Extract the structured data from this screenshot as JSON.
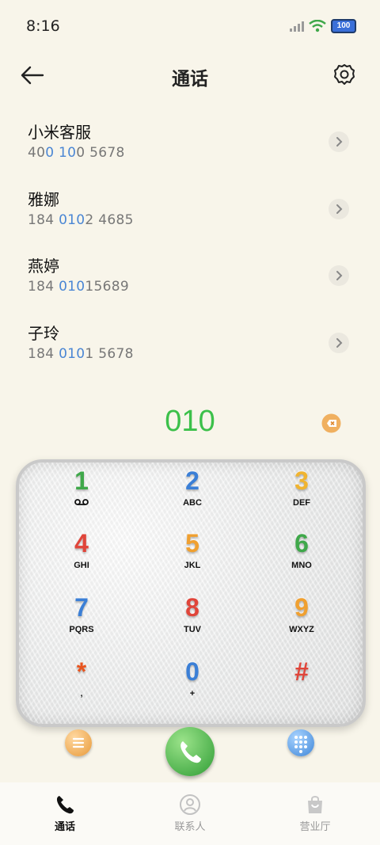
{
  "status_bar": {
    "time": "8:16",
    "battery": "100"
  },
  "header": {
    "title": "通话"
  },
  "contacts": [
    {
      "name": "小米客服",
      "num_pre": "40",
      "num_hl": "0 10",
      "num_post": "0 5678"
    },
    {
      "name": "雅娜",
      "num_pre": "184 ",
      "num_hl": "010",
      "num_post": "2 4685"
    },
    {
      "name": "燕婷",
      "num_pre": "184 ",
      "num_hl": "010",
      "num_post": "15689"
    },
    {
      "name": "子玲",
      "num_pre": "184 ",
      "num_hl": "010",
      "num_post": "1 5678"
    }
  ],
  "dialer": {
    "number": "010"
  },
  "keypad": {
    "keys": [
      {
        "digit": "1",
        "letters": "⌕"
      },
      {
        "digit": "2",
        "letters": "ABC"
      },
      {
        "digit": "3",
        "letters": "DEF"
      },
      {
        "digit": "4",
        "letters": "GHI"
      },
      {
        "digit": "5",
        "letters": "JKL"
      },
      {
        "digit": "6",
        "letters": "MNO"
      },
      {
        "digit": "7",
        "letters": "PQRS"
      },
      {
        "digit": "8",
        "letters": "TUV"
      },
      {
        "digit": "9",
        "letters": "WXYZ"
      },
      {
        "digit": "*",
        "letters": ","
      },
      {
        "digit": "0",
        "letters": "+"
      },
      {
        "digit": "#",
        "letters": ""
      }
    ],
    "digit_colors": [
      "#3fa84a",
      "#3b7fd6",
      "#f0b430",
      "#e0453a",
      "#f0a030",
      "#3fa84a",
      "#3b7fd6",
      "#e0453a",
      "#f0a030",
      "#e8541e",
      "#3b7fd6",
      "#e0453a"
    ]
  },
  "tabs": [
    {
      "label": "通话",
      "icon": "phone-icon",
      "active": true
    },
    {
      "label": "联系人",
      "icon": "person-icon",
      "active": false
    },
    {
      "label": "营业厅",
      "icon": "bag-icon",
      "active": false
    }
  ],
  "colors": {
    "accent_green": "#3cc04a",
    "highlight_blue": "#4a86d4",
    "background": "#f8f5ea"
  }
}
